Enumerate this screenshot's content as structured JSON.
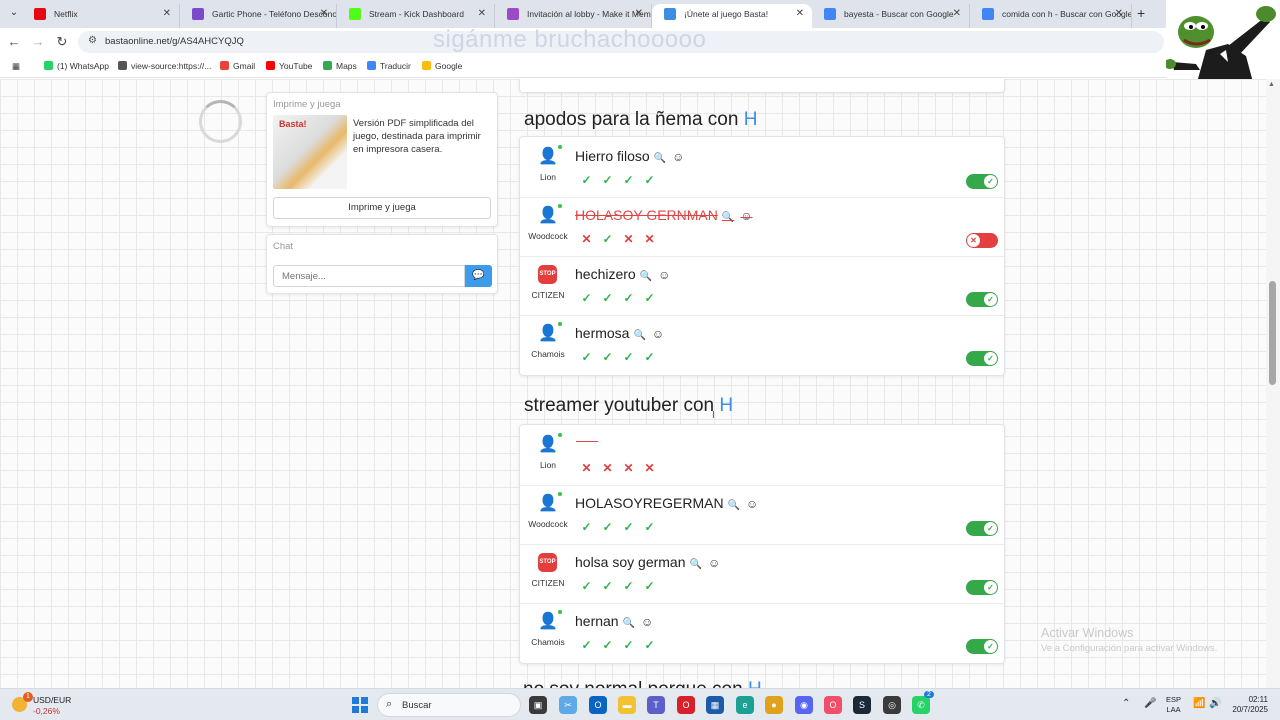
{
  "browser": {
    "tabs": [
      {
        "title": "Netflix",
        "favicon": "netflix-icon",
        "color": "#e50914",
        "active": false
      },
      {
        "title": "Gartic Phone - Teléfono Desconocido",
        "favicon": "gartic-icon",
        "color": "#7b4bc9",
        "active": false
      },
      {
        "title": "Stream - Kick Dashboard",
        "favicon": "kick-icon",
        "color": "#53fc18",
        "active": false
      },
      {
        "title": "Invitación al lobby - Make it Meme",
        "favicon": "makeitmeme-icon",
        "color": "#9b4bc7",
        "active": false
      },
      {
        "title": "¡Únete al juego Basta!",
        "favicon": "basta-icon",
        "color": "#3d8ee0",
        "active": true
      },
      {
        "title": "bayesta - Buscar con Google",
        "favicon": "google-icon",
        "color": "#4285f4",
        "active": false
      },
      {
        "title": "comida con h - Buscar con Google",
        "favicon": "google-icon",
        "color": "#4285f4",
        "active": false
      }
    ],
    "url": "bastaonline.net/g/AS4AHCYQJQ",
    "overlay_text": "sigánme bruchachooooo",
    "bookmarks": [
      {
        "label": "(1) WhatsApp",
        "color": "#25d366"
      },
      {
        "label": "view-source:https://...",
        "color": "#555555"
      },
      {
        "label": "Gmail",
        "color": "#ea4335"
      },
      {
        "label": "YouTube",
        "color": "#ff0000"
      },
      {
        "label": "Maps",
        "color": "#34a853"
      },
      {
        "label": "Traducir",
        "color": "#4285f4"
      },
      {
        "label": "Google",
        "color": "#fbbc05"
      }
    ]
  },
  "sidebar": {
    "print_card": {
      "title": "Imprime y juega",
      "logo": "Basta!",
      "description": "Versión PDF simplificada del juego, destinada para imprimir en impresora casera.",
      "button_label": "Imprime y juega"
    },
    "chat": {
      "title": "Chat",
      "placeholder": "Mensaje..."
    }
  },
  "categories": [
    {
      "title": "apodos para la ñema con",
      "letter": "H",
      "answers": [
        {
          "player": "Lion",
          "avatar": "user-icon",
          "answer": "Hierro filoso",
          "struck": false,
          "votes": [
            "ok",
            "ok",
            "ok",
            "ok"
          ],
          "accepted": true
        },
        {
          "player": "Woodcock",
          "avatar": "user-icon",
          "answer": "HOLASOY GERNMAN",
          "struck": true,
          "votes": [
            "no",
            "ok",
            "no",
            "no"
          ],
          "accepted": false
        },
        {
          "player": "CITIZEN",
          "avatar": "stop-icon",
          "answer": "hechizero",
          "struck": false,
          "votes": [
            "ok",
            "ok",
            "ok",
            "ok"
          ],
          "accepted": true
        },
        {
          "player": "Chamois",
          "avatar": "user-icon",
          "answer": "hermosa",
          "struck": false,
          "votes": [
            "ok",
            "ok",
            "ok",
            "ok"
          ],
          "accepted": true
        }
      ]
    },
    {
      "title": "streamer youtuber con",
      "letter": "H",
      "answers": [
        {
          "player": "Lion",
          "avatar": "user-icon",
          "answer": "",
          "struck": true,
          "votes": [
            "no",
            "no",
            "no",
            "no"
          ],
          "accepted": null
        },
        {
          "player": "Woodcock",
          "avatar": "user-icon",
          "answer": "HOLASOYREGERMAN",
          "struck": false,
          "votes": [
            "ok",
            "ok",
            "ok",
            "ok"
          ],
          "accepted": true
        },
        {
          "player": "CITIZEN",
          "avatar": "stop-icon",
          "answer": "holsa soy german",
          "struck": false,
          "votes": [
            "ok",
            "ok",
            "ok",
            "ok"
          ],
          "accepted": true
        },
        {
          "player": "Chamois",
          "avatar": "user-icon",
          "answer": "hernan",
          "struck": false,
          "votes": [
            "ok",
            "ok",
            "ok",
            "ok"
          ],
          "accepted": true
        }
      ]
    }
  ],
  "next_category": {
    "title": "no soy normal porque con",
    "letter": "H"
  },
  "stop_label": "STOP",
  "watermark": {
    "line1": "Activar Windows",
    "line2": "Ve a Configuración para activar Windows."
  },
  "taskbar": {
    "weather_label": "USD/EUR",
    "weather_value": "-0,26%",
    "weather_badge": "1",
    "search_label": "Buscar",
    "language": "ESP",
    "language_sub": "LAA",
    "time": "02:11",
    "date": "20/7/2025",
    "whatsapp_badge": "2"
  },
  "colors": {
    "accent": "#3d8ee0",
    "ok": "#2fb34a",
    "no": "#e23c3c",
    "toggle_on": "#35a84a",
    "toggle_off": "#e54040"
  }
}
